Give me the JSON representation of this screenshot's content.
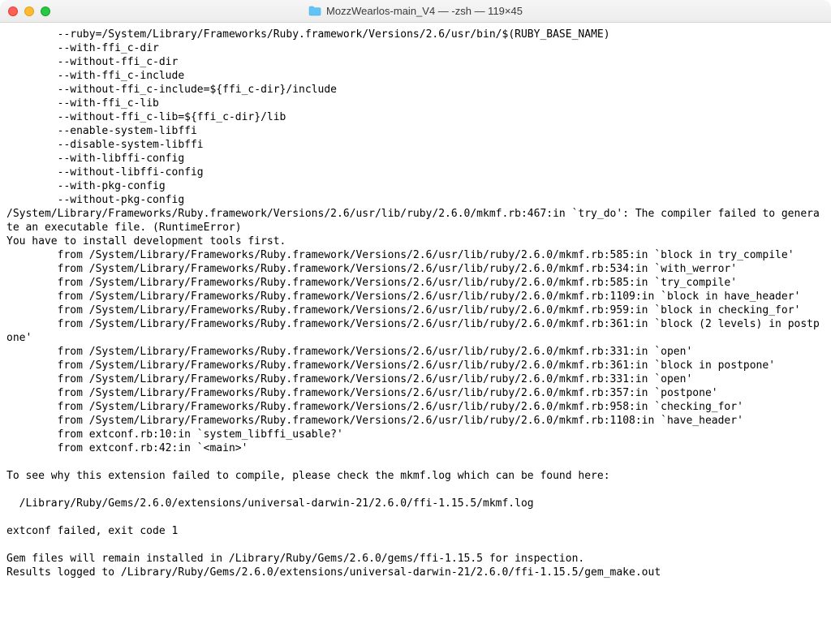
{
  "window": {
    "title": "MozzWearlos-main_V4 — -zsh — 119×45"
  },
  "terminal": {
    "lines": [
      "        --ruby=/System/Library/Frameworks/Ruby.framework/Versions/2.6/usr/bin/$(RUBY_BASE_NAME)",
      "        --with-ffi_c-dir",
      "        --without-ffi_c-dir",
      "        --with-ffi_c-include",
      "        --without-ffi_c-include=${ffi_c-dir}/include",
      "        --with-ffi_c-lib",
      "        --without-ffi_c-lib=${ffi_c-dir}/lib",
      "        --enable-system-libffi",
      "        --disable-system-libffi",
      "        --with-libffi-config",
      "        --without-libffi-config",
      "        --with-pkg-config",
      "        --without-pkg-config",
      "/System/Library/Frameworks/Ruby.framework/Versions/2.6/usr/lib/ruby/2.6.0/mkmf.rb:467:in `try_do': The compiler failed to generate an executable file. (RuntimeError)",
      "You have to install development tools first.",
      "        from /System/Library/Frameworks/Ruby.framework/Versions/2.6/usr/lib/ruby/2.6.0/mkmf.rb:585:in `block in try_compile'",
      "        from /System/Library/Frameworks/Ruby.framework/Versions/2.6/usr/lib/ruby/2.6.0/mkmf.rb:534:in `with_werror'",
      "        from /System/Library/Frameworks/Ruby.framework/Versions/2.6/usr/lib/ruby/2.6.0/mkmf.rb:585:in `try_compile'",
      "        from /System/Library/Frameworks/Ruby.framework/Versions/2.6/usr/lib/ruby/2.6.0/mkmf.rb:1109:in `block in have_header'",
      "        from /System/Library/Frameworks/Ruby.framework/Versions/2.6/usr/lib/ruby/2.6.0/mkmf.rb:959:in `block in checking_for'",
      "        from /System/Library/Frameworks/Ruby.framework/Versions/2.6/usr/lib/ruby/2.6.0/mkmf.rb:361:in `block (2 levels) in postpone'",
      "        from /System/Library/Frameworks/Ruby.framework/Versions/2.6/usr/lib/ruby/2.6.0/mkmf.rb:331:in `open'",
      "        from /System/Library/Frameworks/Ruby.framework/Versions/2.6/usr/lib/ruby/2.6.0/mkmf.rb:361:in `block in postpone'",
      "        from /System/Library/Frameworks/Ruby.framework/Versions/2.6/usr/lib/ruby/2.6.0/mkmf.rb:331:in `open'",
      "        from /System/Library/Frameworks/Ruby.framework/Versions/2.6/usr/lib/ruby/2.6.0/mkmf.rb:357:in `postpone'",
      "        from /System/Library/Frameworks/Ruby.framework/Versions/2.6/usr/lib/ruby/2.6.0/mkmf.rb:958:in `checking_for'",
      "        from /System/Library/Frameworks/Ruby.framework/Versions/2.6/usr/lib/ruby/2.6.0/mkmf.rb:1108:in `have_header'",
      "        from extconf.rb:10:in `system_libffi_usable?'",
      "        from extconf.rb:42:in `<main>'",
      "",
      "To see why this extension failed to compile, please check the mkmf.log which can be found here:",
      "",
      "  /Library/Ruby/Gems/2.6.0/extensions/universal-darwin-21/2.6.0/ffi-1.15.5/mkmf.log",
      "",
      "extconf failed, exit code 1",
      "",
      "Gem files will remain installed in /Library/Ruby/Gems/2.6.0/gems/ffi-1.15.5 for inspection.",
      "Results logged to /Library/Ruby/Gems/2.6.0/extensions/universal-darwin-21/2.6.0/ffi-1.15.5/gem_make.out"
    ]
  }
}
